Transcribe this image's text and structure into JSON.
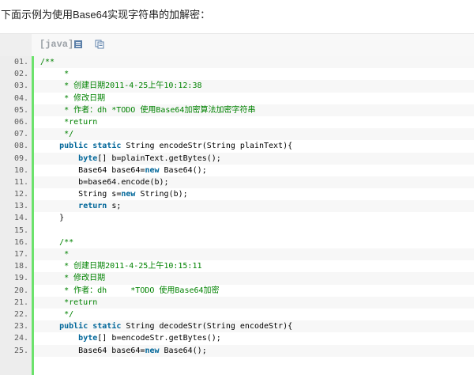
{
  "intro": "下面示例为使用Base64实现字符串的加解密：",
  "toolbar": {
    "language": "[java]",
    "view_plain_icon": "view-plain-icon",
    "copy_icon": "copy-icon"
  },
  "colors": {
    "gutter_border": "#6ce26c",
    "comment": "#008200",
    "keyword": "#006699",
    "toolbar_text": "#9aa0a6"
  },
  "code_lines": [
    {
      "num": "01.",
      "tokens": [
        {
          "t": "c",
          "s": "/**"
        }
      ]
    },
    {
      "num": "02.",
      "tokens": [
        {
          "t": "c",
          "s": "     *"
        }
      ]
    },
    {
      "num": "03.",
      "tokens": [
        {
          "t": "c",
          "s": "     * 创建日期2011-4-25上午10:12:38"
        }
      ]
    },
    {
      "num": "04.",
      "tokens": [
        {
          "t": "c",
          "s": "     * 修改日期"
        }
      ]
    },
    {
      "num": "05.",
      "tokens": [
        {
          "t": "c",
          "s": "     * 作者：dh *TODO 使用Base64加密算法加密字符串"
        }
      ]
    },
    {
      "num": "06.",
      "tokens": [
        {
          "t": "c",
          "s": "     *return"
        }
      ]
    },
    {
      "num": "07.",
      "tokens": [
        {
          "t": "c",
          "s": "     */"
        }
      ]
    },
    {
      "num": "08.",
      "tokens": [
        {
          "t": "p",
          "s": "    "
        },
        {
          "t": "k",
          "s": "public static"
        },
        {
          "t": "p",
          "s": " String encodeStr(String plainText){"
        }
      ]
    },
    {
      "num": "09.",
      "tokens": [
        {
          "t": "p",
          "s": "        "
        },
        {
          "t": "k",
          "s": "byte"
        },
        {
          "t": "p",
          "s": "[] b=plainText.getBytes();"
        }
      ]
    },
    {
      "num": "10.",
      "tokens": [
        {
          "t": "p",
          "s": "        Base64 base64="
        },
        {
          "t": "k",
          "s": "new"
        },
        {
          "t": "p",
          "s": " Base64();"
        }
      ]
    },
    {
      "num": "11.",
      "tokens": [
        {
          "t": "p",
          "s": "        b=base64.encode(b);"
        }
      ]
    },
    {
      "num": "12.",
      "tokens": [
        {
          "t": "p",
          "s": "        String s="
        },
        {
          "t": "k",
          "s": "new"
        },
        {
          "t": "p",
          "s": " String(b);"
        }
      ]
    },
    {
      "num": "13.",
      "tokens": [
        {
          "t": "p",
          "s": "        "
        },
        {
          "t": "k",
          "s": "return"
        },
        {
          "t": "p",
          "s": " s;"
        }
      ]
    },
    {
      "num": "14.",
      "tokens": [
        {
          "t": "p",
          "s": "    }"
        }
      ]
    },
    {
      "num": "15.",
      "tokens": [
        {
          "t": "p",
          "s": ""
        }
      ]
    },
    {
      "num": "16.",
      "tokens": [
        {
          "t": "c",
          "s": "    /**"
        }
      ]
    },
    {
      "num": "17.",
      "tokens": [
        {
          "t": "c",
          "s": "     *"
        }
      ]
    },
    {
      "num": "18.",
      "tokens": [
        {
          "t": "c",
          "s": "     * 创建日期2011-4-25上午10:15:11"
        }
      ]
    },
    {
      "num": "19.",
      "tokens": [
        {
          "t": "c",
          "s": "     * 修改日期"
        }
      ]
    },
    {
      "num": "20.",
      "tokens": [
        {
          "t": "c",
          "s": "     * 作者：dh     *TODO 使用Base64加密"
        }
      ]
    },
    {
      "num": "21.",
      "tokens": [
        {
          "t": "c",
          "s": "     *return"
        }
      ]
    },
    {
      "num": "22.",
      "tokens": [
        {
          "t": "c",
          "s": "     */"
        }
      ]
    },
    {
      "num": "23.",
      "tokens": [
        {
          "t": "p",
          "s": "    "
        },
        {
          "t": "k",
          "s": "public static"
        },
        {
          "t": "p",
          "s": " String decodeStr(String encodeStr){"
        }
      ]
    },
    {
      "num": "24.",
      "tokens": [
        {
          "t": "p",
          "s": "        "
        },
        {
          "t": "k",
          "s": "byte"
        },
        {
          "t": "p",
          "s": "[] b=encodeStr.getBytes();"
        }
      ]
    },
    {
      "num": "25.",
      "tokens": [
        {
          "t": "p",
          "s": "        Base64 base64="
        },
        {
          "t": "k",
          "s": "new"
        },
        {
          "t": "p",
          "s": " Base64();"
        }
      ]
    }
  ]
}
